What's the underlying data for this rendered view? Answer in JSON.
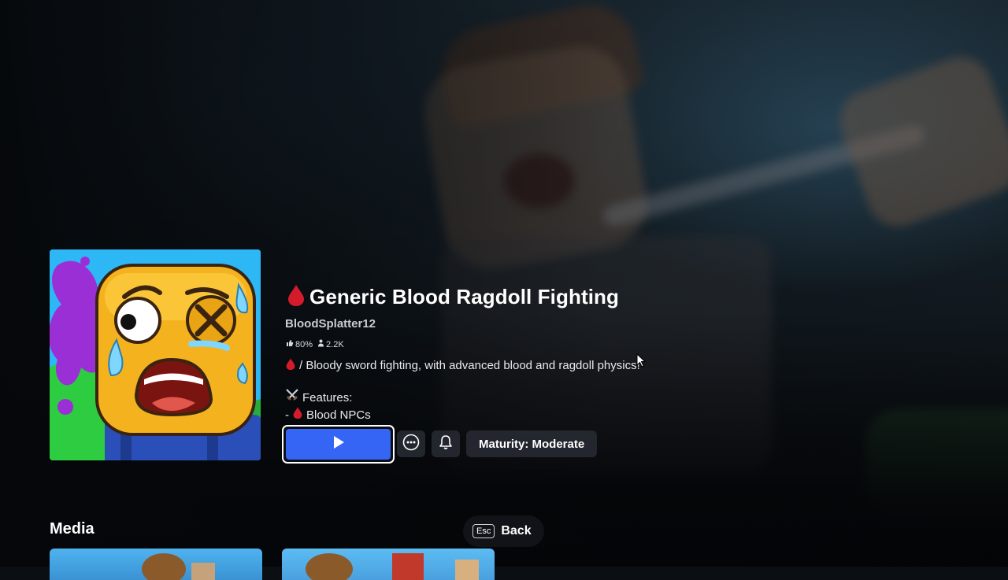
{
  "game": {
    "title": "Generic Blood Ragdoll Fighting",
    "creator": "BloodSplatter12",
    "rating": "80%",
    "players": "2.2K",
    "description": "/ Bloody sword fighting, with advanced blood and ragdoll physics!",
    "features_heading": "Features:",
    "feature_prefix": "-",
    "feature_1": "Blood NPCs"
  },
  "actions": {
    "maturity_label": "Maturity: Moderate"
  },
  "media": {
    "heading": "Media"
  },
  "back": {
    "key": "Esc",
    "label": "Back"
  },
  "icons": {
    "title_icon": "blood-drop-icon",
    "rating_icon": "thumbs-up-icon",
    "players_icon": "players-icon",
    "features_icon": "crossed-swords-icon",
    "play_icon": "play-icon",
    "more_icon": "more-options-icon",
    "notify_icon": "bell-icon"
  },
  "colors": {
    "play_button": "#3565f5",
    "blood": "#d41b2c",
    "background": "#0b0e13"
  }
}
